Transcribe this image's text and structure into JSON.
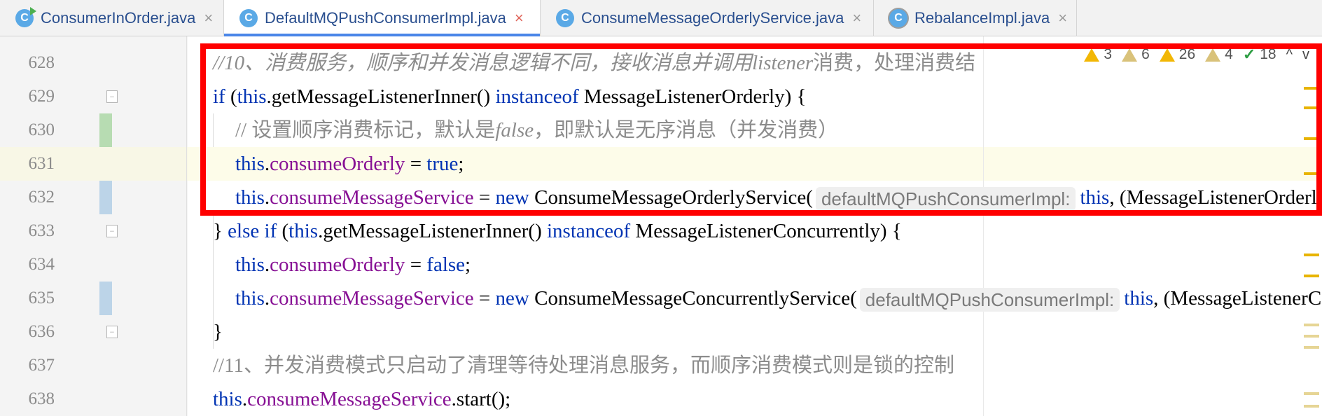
{
  "tabs": [
    {
      "label": "ConsumerInOrder.java",
      "icon": "class-run-icon",
      "active": false
    },
    {
      "label": "DefaultMQPushConsumerImpl.java",
      "icon": "class-icon",
      "active": true
    },
    {
      "label": "ConsumeMessageOrderlyService.java",
      "icon": "class-icon",
      "active": false
    },
    {
      "label": "RebalanceImpl.java",
      "icon": "class-readonly-icon",
      "active": false
    }
  ],
  "tab_icon_letter": "C",
  "close_glyph": "×",
  "inspections": {
    "warnings": "3",
    "weak_warnings_a": "6",
    "warnings_b": "26",
    "weak_warnings_b": "4",
    "typos": "18",
    "up_arrow": "^",
    "down_arrow": "v"
  },
  "line_numbers": [
    "628",
    "629",
    "630",
    "631",
    "632",
    "633",
    "634",
    "635",
    "636",
    "637",
    "638"
  ],
  "code": {
    "l628": {
      "prefix": "//10、消费服务，顺序和并发消息逻辑不同，接收消息并调用",
      "italic": "listener",
      "suffix": "消费，处理消费结"
    },
    "l629": {
      "kw_if": "if",
      "p1": " (",
      "this": "this",
      "p2": ".getMessageListenerInner() ",
      "instanceof": "instanceof",
      "p3": " MessageListenerOrderly) {"
    },
    "l630": {
      "prefix": "// 设置顺序消费标记，默认是",
      "italic": "false",
      "suffix": "，即默认是无序消息（并发消费）"
    },
    "l631": {
      "this": "this",
      "p1": ".",
      "field": "consumeOrderly",
      "p2": " = ",
      "value": "true",
      "p3": ";"
    },
    "l632": {
      "this": "this",
      "p1": ".",
      "field": "consumeMessageService",
      "p2": " = ",
      "new": "new",
      "p3": " ConsumeMessageOrderlyService(",
      "hint": "defaultMQPushConsumerImpl:",
      "this2": "this",
      "p4": ", (MessageListenerOrderly)"
    },
    "l633": {
      "p0": "} ",
      "kw_else": "else",
      "p1": " ",
      "kw_if": "if",
      "p2": " (",
      "this": "this",
      "p3": ".getMessageListenerInner() ",
      "instanceof": "instanceof",
      "p4": " MessageListenerConcurrently) {"
    },
    "l634": {
      "this": "this",
      "p1": ".",
      "field": "consumeOrderly",
      "p2": " = ",
      "value": "false",
      "p3": ";"
    },
    "l635": {
      "this": "this",
      "p1": ".",
      "field": "consumeMessageService",
      "p2": " = ",
      "new": "new",
      "p3": " ConsumeMessageConcurrentlyService(",
      "hint": "defaultMQPushConsumerImpl:",
      "this2": "this",
      "p4": ", (MessageListenerConcurrently)"
    },
    "l636": {
      "text": "}"
    },
    "l637": {
      "prefix": "//11、并发消费模式只启动了清理等待处理消息服务，而顺序消费模式则是锁的控制"
    },
    "l638": {
      "this": "this",
      "p1": ".",
      "field": "consumeMessageService",
      "p2": ".start();"
    }
  }
}
